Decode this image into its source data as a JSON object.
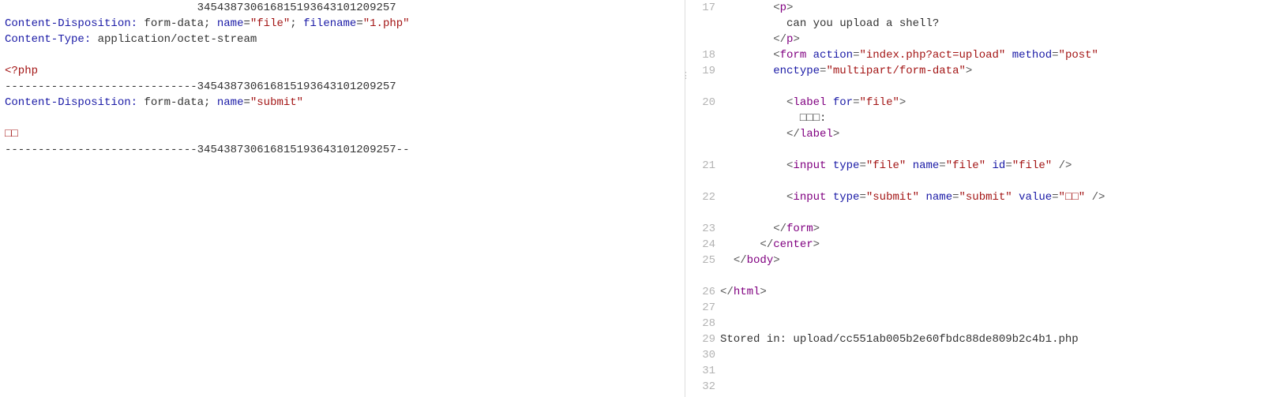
{
  "left": {
    "lines": [
      {
        "segments": [
          {
            "cls": "tok-text",
            "t": "                             345438730616815193643101209257"
          }
        ]
      },
      {
        "segments": [
          {
            "cls": "tok-key",
            "t": "Content-Disposition:"
          },
          {
            "cls": "tok-text",
            "t": " form-data; "
          },
          {
            "cls": "tok-key",
            "t": "name"
          },
          {
            "cls": "tok-text",
            "t": "="
          },
          {
            "cls": "tok-str",
            "t": "\"file\""
          },
          {
            "cls": "tok-text",
            "t": "; "
          },
          {
            "cls": "tok-key",
            "t": "filename"
          },
          {
            "cls": "tok-text",
            "t": "="
          },
          {
            "cls": "tok-str",
            "t": "\"1.php\""
          }
        ]
      },
      {
        "segments": [
          {
            "cls": "tok-key",
            "t": "Content-Type:"
          },
          {
            "cls": "tok-text",
            "t": " application/octet-stream"
          }
        ]
      },
      {
        "segments": [
          {
            "cls": "tok-text",
            "t": ""
          }
        ]
      },
      {
        "segments": [
          {
            "cls": "tok-phpo",
            "t": "<?php"
          }
        ]
      },
      {
        "segments": [
          {
            "cls": "tok-text",
            "t": "-----------------------------345438730616815193643101209257"
          }
        ]
      },
      {
        "segments": [
          {
            "cls": "tok-key",
            "t": "Content-Disposition:"
          },
          {
            "cls": "tok-text",
            "t": " form-data; "
          },
          {
            "cls": "tok-key",
            "t": "name"
          },
          {
            "cls": "tok-text",
            "t": "="
          },
          {
            "cls": "tok-str",
            "t": "\"submit\""
          }
        ]
      },
      {
        "segments": [
          {
            "cls": "tok-text",
            "t": ""
          }
        ]
      },
      {
        "segments": [
          {
            "cls": "tok-str",
            "t": "□□"
          }
        ]
      },
      {
        "segments": [
          {
            "cls": "tok-text",
            "t": "-----------------------------345438730616815193643101209257--"
          }
        ]
      }
    ]
  },
  "right": {
    "lines": [
      {
        "no": "17",
        "segments": [
          {
            "cls": "tok-text",
            "t": "        "
          },
          {
            "cls": "tok-punc",
            "t": "<"
          },
          {
            "cls": "tok-tag",
            "t": "p"
          },
          {
            "cls": "tok-punc",
            "t": ">"
          }
        ]
      },
      {
        "no": "",
        "segments": [
          {
            "cls": "tok-text",
            "t": "          can you upload a shell?"
          }
        ]
      },
      {
        "no": "",
        "segments": [
          {
            "cls": "tok-text",
            "t": "        "
          },
          {
            "cls": "tok-punc",
            "t": "</"
          },
          {
            "cls": "tok-tag",
            "t": "p"
          },
          {
            "cls": "tok-punc",
            "t": ">"
          }
        ]
      },
      {
        "no": "18",
        "segments": [
          {
            "cls": "tok-text",
            "t": "        "
          },
          {
            "cls": "tok-punc",
            "t": "<"
          },
          {
            "cls": "tok-tag",
            "t": "form"
          },
          {
            "cls": "tok-text",
            "t": " "
          },
          {
            "cls": "tok-key",
            "t": "action"
          },
          {
            "cls": "tok-punc",
            "t": "="
          },
          {
            "cls": "tok-str",
            "t": "\"index.php?act=upload\""
          },
          {
            "cls": "tok-text",
            "t": " "
          },
          {
            "cls": "tok-key",
            "t": "method"
          },
          {
            "cls": "tok-punc",
            "t": "="
          },
          {
            "cls": "tok-str",
            "t": "\"post\""
          }
        ]
      },
      {
        "no": "19",
        "segments": [
          {
            "cls": "tok-text",
            "t": "        "
          },
          {
            "cls": "tok-key",
            "t": "enctype"
          },
          {
            "cls": "tok-punc",
            "t": "="
          },
          {
            "cls": "tok-str",
            "t": "\"multipart/form-data\""
          },
          {
            "cls": "tok-punc",
            "t": ">"
          }
        ]
      },
      {
        "no": "",
        "segments": [
          {
            "cls": "tok-text",
            "t": ""
          }
        ]
      },
      {
        "no": "20",
        "segments": [
          {
            "cls": "tok-text",
            "t": "          "
          },
          {
            "cls": "tok-punc",
            "t": "<"
          },
          {
            "cls": "tok-tag",
            "t": "label"
          },
          {
            "cls": "tok-text",
            "t": " "
          },
          {
            "cls": "tok-key",
            "t": "for"
          },
          {
            "cls": "tok-punc",
            "t": "="
          },
          {
            "cls": "tok-str",
            "t": "\"file\""
          },
          {
            "cls": "tok-punc",
            "t": ">"
          }
        ]
      },
      {
        "no": "",
        "segments": [
          {
            "cls": "tok-text",
            "t": "            □□□:"
          }
        ]
      },
      {
        "no": "",
        "segments": [
          {
            "cls": "tok-text",
            "t": "          "
          },
          {
            "cls": "tok-punc",
            "t": "</"
          },
          {
            "cls": "tok-tag",
            "t": "label"
          },
          {
            "cls": "tok-punc",
            "t": ">"
          }
        ]
      },
      {
        "no": "",
        "segments": [
          {
            "cls": "tok-text",
            "t": ""
          }
        ]
      },
      {
        "no": "21",
        "segments": [
          {
            "cls": "tok-text",
            "t": "          "
          },
          {
            "cls": "tok-punc",
            "t": "<"
          },
          {
            "cls": "tok-tag",
            "t": "input"
          },
          {
            "cls": "tok-text",
            "t": " "
          },
          {
            "cls": "tok-key",
            "t": "type"
          },
          {
            "cls": "tok-punc",
            "t": "="
          },
          {
            "cls": "tok-str",
            "t": "\"file\""
          },
          {
            "cls": "tok-text",
            "t": " "
          },
          {
            "cls": "tok-key",
            "t": "name"
          },
          {
            "cls": "tok-punc",
            "t": "="
          },
          {
            "cls": "tok-str",
            "t": "\"file\""
          },
          {
            "cls": "tok-text",
            "t": " "
          },
          {
            "cls": "tok-key",
            "t": "id"
          },
          {
            "cls": "tok-punc",
            "t": "="
          },
          {
            "cls": "tok-str",
            "t": "\"file\""
          },
          {
            "cls": "tok-text",
            "t": " "
          },
          {
            "cls": "tok-punc",
            "t": "/>"
          }
        ]
      },
      {
        "no": "",
        "segments": [
          {
            "cls": "tok-text",
            "t": ""
          }
        ]
      },
      {
        "no": "22",
        "segments": [
          {
            "cls": "tok-text",
            "t": "          "
          },
          {
            "cls": "tok-punc",
            "t": "<"
          },
          {
            "cls": "tok-tag",
            "t": "input"
          },
          {
            "cls": "tok-text",
            "t": " "
          },
          {
            "cls": "tok-key",
            "t": "type"
          },
          {
            "cls": "tok-punc",
            "t": "="
          },
          {
            "cls": "tok-str",
            "t": "\"submit\""
          },
          {
            "cls": "tok-text",
            "t": " "
          },
          {
            "cls": "tok-key",
            "t": "name"
          },
          {
            "cls": "tok-punc",
            "t": "="
          },
          {
            "cls": "tok-str",
            "t": "\"submit\""
          },
          {
            "cls": "tok-text",
            "t": " "
          },
          {
            "cls": "tok-key",
            "t": "value"
          },
          {
            "cls": "tok-punc",
            "t": "="
          },
          {
            "cls": "tok-str",
            "t": "\"□□\""
          },
          {
            "cls": "tok-text",
            "t": " "
          },
          {
            "cls": "tok-punc",
            "t": "/>"
          }
        ]
      },
      {
        "no": "",
        "segments": [
          {
            "cls": "tok-text",
            "t": ""
          }
        ]
      },
      {
        "no": "23",
        "segments": [
          {
            "cls": "tok-text",
            "t": "        "
          },
          {
            "cls": "tok-punc",
            "t": "</"
          },
          {
            "cls": "tok-tag",
            "t": "form"
          },
          {
            "cls": "tok-punc",
            "t": ">"
          }
        ]
      },
      {
        "no": "24",
        "segments": [
          {
            "cls": "tok-text",
            "t": "      "
          },
          {
            "cls": "tok-punc",
            "t": "</"
          },
          {
            "cls": "tok-tag",
            "t": "center"
          },
          {
            "cls": "tok-punc",
            "t": ">"
          }
        ]
      },
      {
        "no": "25",
        "segments": [
          {
            "cls": "tok-text",
            "t": "  "
          },
          {
            "cls": "tok-punc",
            "t": "</"
          },
          {
            "cls": "tok-tag",
            "t": "body"
          },
          {
            "cls": "tok-punc",
            "t": ">"
          }
        ]
      },
      {
        "no": "",
        "segments": [
          {
            "cls": "tok-text",
            "t": ""
          }
        ]
      },
      {
        "no": "26",
        "segments": [
          {
            "cls": "tok-punc",
            "t": "</"
          },
          {
            "cls": "tok-tag",
            "t": "html"
          },
          {
            "cls": "tok-punc",
            "t": ">"
          }
        ]
      },
      {
        "no": "27",
        "segments": [
          {
            "cls": "tok-text",
            "t": ""
          }
        ]
      },
      {
        "no": "28",
        "segments": [
          {
            "cls": "tok-text",
            "t": ""
          }
        ]
      },
      {
        "no": "29",
        "segments": [
          {
            "cls": "tok-text",
            "t": "Stored in: upload/cc551ab005b2e60fbdc88de809b2c4b1.php"
          }
        ]
      },
      {
        "no": "30",
        "segments": [
          {
            "cls": "tok-text",
            "t": ""
          }
        ]
      },
      {
        "no": "31",
        "segments": [
          {
            "cls": "tok-text",
            "t": ""
          }
        ]
      },
      {
        "no": "32",
        "segments": [
          {
            "cls": "tok-text",
            "t": ""
          }
        ]
      }
    ]
  },
  "divider_dots": "⋮"
}
